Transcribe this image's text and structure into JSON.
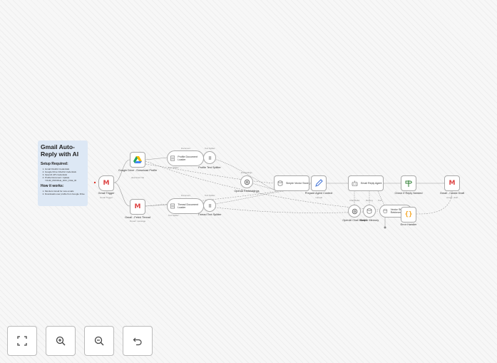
{
  "sticky": {
    "title": "Gmail Auto-Reply with AI",
    "setup_heading": "Setup Required:",
    "setup_items": [
      "Gmail OAuth2 credentials",
      "Google Drive OAuth2 credentials",
      "OpenAI API credentials",
      "Profile Document: Update YOUR_PROFILE_DOC_FILE_ID"
    ],
    "how_heading": "How it works:",
    "how_items": [
      "Monitors Gmail for new emails",
      "Downloads user profile from Google Drive"
    ]
  },
  "nodes": {
    "gmail_trigger": {
      "label": "Gmail Trigger",
      "sub": "Gmail Trigger"
    },
    "gdrive_download": {
      "label": "Google Drive - Download Profile",
      "sub": "download: file"
    },
    "gmail_fetch": {
      "label": "Gmail - Fetch Thread",
      "sub": "thread: message"
    },
    "profile_loader": {
      "label": "Profile Document Loader"
    },
    "thread_loader": {
      "label": "Thread Document Loader"
    },
    "profile_splitter": {
      "label": "Profile Text Splitter"
    },
    "thread_splitter": {
      "label": "Thread Text Splitter"
    },
    "openai_embeddings": {
      "label": "OpenAI Embeddings"
    },
    "vector_store": {
      "label": "Simple Vector Store"
    },
    "prepare_context": {
      "label": "Prepare Agent Context",
      "sub": "manual"
    },
    "email_agent": {
      "label": "Email Reply Agent"
    },
    "openai_chat": {
      "label": "OpenAI Chat Model"
    },
    "simple_memory": {
      "label": "Simple Memory"
    },
    "vector_retriever": {
      "label": "Vector Store Retriever"
    },
    "check_reply": {
      "label": "Check If Reply Needed"
    },
    "error_handler": {
      "label": "Error Handler"
    },
    "gmail_draft": {
      "label": "Gmail - Create Draft",
      "sub": "create: draft"
    }
  },
  "tags": {
    "document": "Document",
    "text_splitter": "Text Splitter",
    "embeddings": "Embeddings",
    "chat_model": "Chat Model",
    "memory": "Memory",
    "tool": "Tool"
  },
  "colors": {
    "edge": "#9a9a9a",
    "gmail_red": "#d93025",
    "drive_green": "#1ea362",
    "drive_blue": "#4285f4",
    "drive_yellow": "#fbbc04",
    "check_green": "#2e7d32",
    "error_yellow": "#f5a623",
    "agent_blue": "#3b6fd6"
  },
  "controls": {
    "fit_view": "fit-view-icon",
    "zoom_in": "zoom-in-icon",
    "zoom_out": "zoom-out-icon",
    "reset_zoom": "undo-icon"
  }
}
